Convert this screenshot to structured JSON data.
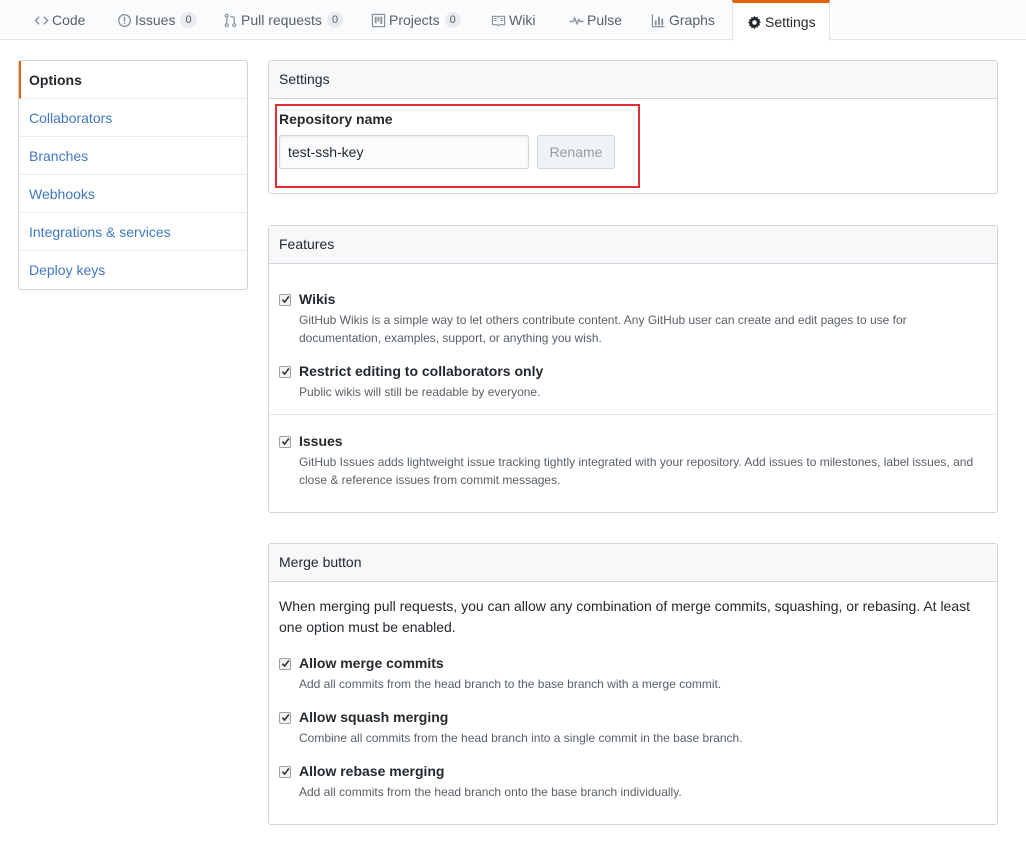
{
  "nav": {
    "tabs": [
      {
        "label": "Code",
        "icon": "code-icon"
      },
      {
        "label": "Issues",
        "count": "0",
        "icon": "issue-opened-icon"
      },
      {
        "label": "Pull requests",
        "count": "0",
        "icon": "git-pull-request-icon"
      },
      {
        "label": "Projects",
        "count": "0",
        "icon": "project-icon"
      },
      {
        "label": "Wiki",
        "icon": "book-icon"
      },
      {
        "label": "Pulse",
        "icon": "pulse-icon"
      },
      {
        "label": "Graphs",
        "icon": "graph-icon"
      },
      {
        "label": "Settings",
        "icon": "gear-icon",
        "selected": true
      }
    ]
  },
  "sidebar": {
    "items": [
      {
        "label": "Options",
        "selected": true
      },
      {
        "label": "Collaborators"
      },
      {
        "label": "Branches"
      },
      {
        "label": "Webhooks"
      },
      {
        "label": "Integrations & services"
      },
      {
        "label": "Deploy keys"
      }
    ]
  },
  "settings": {
    "header": "Settings",
    "repo_name_label": "Repository name",
    "repo_name_value": "test-ssh-key",
    "rename_label": "Rename"
  },
  "features": {
    "header": "Features",
    "options": [
      {
        "title": "Wikis",
        "desc": "GitHub Wikis is a simple way to let others contribute content. Any GitHub user can create and edit pages to use for documentation, examples, support, or anything you wish.",
        "checked": true
      },
      {
        "title": "Restrict editing to collaborators only",
        "desc": "Public wikis will still be readable by everyone.",
        "checked": true
      },
      {
        "title": "Issues",
        "desc": "GitHub Issues adds lightweight issue tracking tightly integrated with your repository. Add issues to milestones, label issues, and close & reference issues from commit messages.",
        "checked": true
      }
    ]
  },
  "merge": {
    "header": "Merge button",
    "intro": "When merging pull requests, you can allow any combination of merge commits, squashing, or rebasing. At least one option must be enabled.",
    "options": [
      {
        "title": "Allow merge commits",
        "desc": "Add all commits from the head branch to the base branch with a merge commit.",
        "checked": true
      },
      {
        "title": "Allow squash merging",
        "desc": "Combine all commits from the head branch into a single commit in the base branch.",
        "checked": true
      },
      {
        "title": "Allow rebase merging",
        "desc": "Add all commits from the head branch onto the base branch individually.",
        "checked": true
      }
    ]
  },
  "colors": {
    "accent": "#e36209",
    "link": "#4078c0",
    "highlight": "#e22e34"
  }
}
